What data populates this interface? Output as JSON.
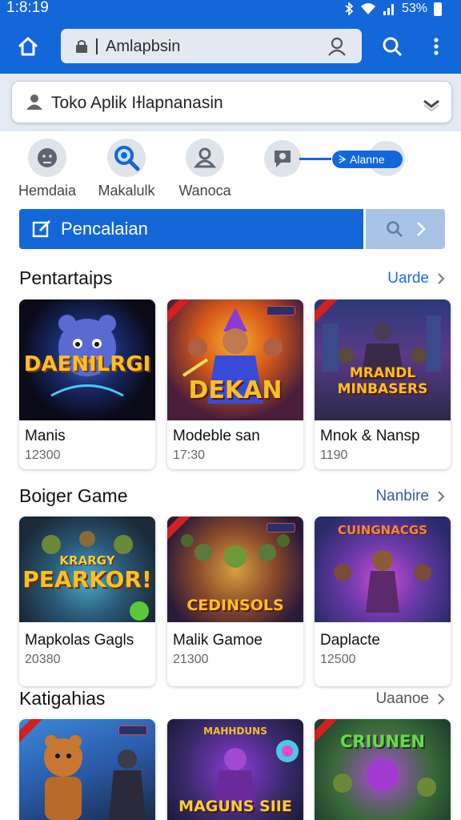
{
  "status": {
    "time": "1:8:19",
    "battery": "53%"
  },
  "toolbar": {
    "url_text": "Amlapbsin"
  },
  "store_search": {
    "text": "Toko Aplik Iɫlapnanasin"
  },
  "categories": [
    {
      "label": "Hemdaia",
      "icon": "face-icon"
    },
    {
      "label": "Makalulk",
      "icon": "search-icon"
    },
    {
      "label": "Wanoca",
      "icon": "user-icon"
    }
  ],
  "chat_tag": {
    "label": "ᗒ Alanne"
  },
  "search_button": {
    "label": "Pencalaian"
  },
  "sections": [
    {
      "title": "Pentartaips",
      "more": "Uarde",
      "cards": [
        {
          "art_title": "DAENILRGI",
          "name": "Manis",
          "count": "12300"
        },
        {
          "art_title": "DEKAN",
          "name": "Modeble san",
          "count": "17:30"
        },
        {
          "art_title": "MRANDL MINBASERS",
          "name": "Mnok & Nansp",
          "count": "1190"
        }
      ]
    },
    {
      "title": "Boiger Game",
      "more": "Nanbire",
      "cards": [
        {
          "art_title": "PEARKOR!",
          "art_sub": "KRARGY",
          "name": "Mapkolas Gagls",
          "count": "20380"
        },
        {
          "art_title": "CEDINSOLS",
          "name": "Malik Gamoe",
          "count": "21300"
        },
        {
          "art_title": "CUINGNACGS",
          "name": "Daplacte",
          "count": "12500"
        }
      ]
    },
    {
      "title": "Katigahias",
      "more": "Uaanoe",
      "cards": [
        {
          "art_title": ""
        },
        {
          "art_title": "MAGUNS SIIE",
          "art_top": "MAHHDUNS"
        },
        {
          "art_title": "CRIUNEN"
        }
      ]
    }
  ],
  "colors": {
    "primary": "#1467d8",
    "accent_gold": "#f9c023"
  }
}
